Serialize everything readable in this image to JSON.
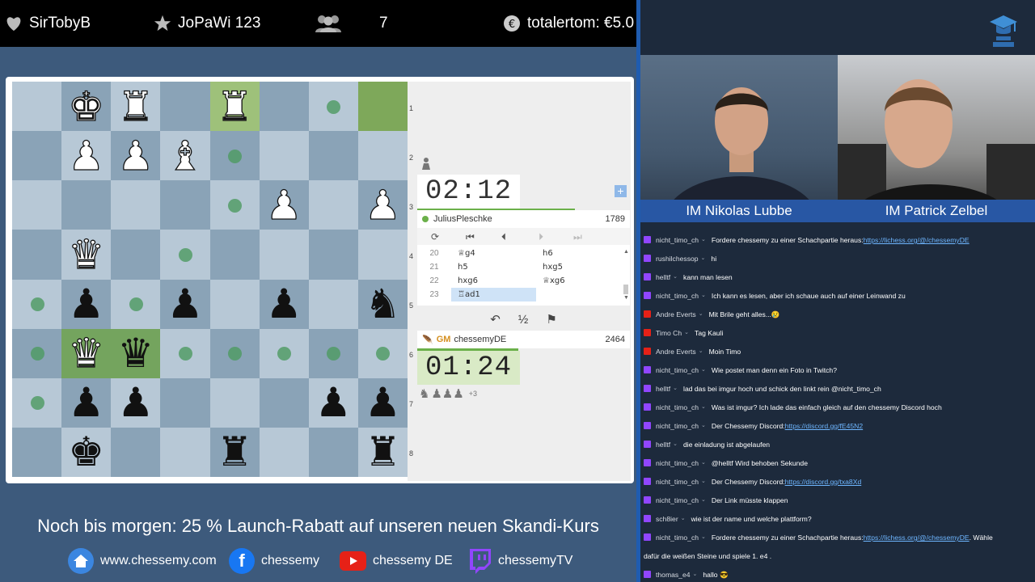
{
  "topbar": {
    "follower": "SirTobyB",
    "subscriber": "JoPaWi 123",
    "viewers": "7",
    "donation": "totalertom: €5.0"
  },
  "board": {
    "squares": [
      [
        "",
        "wK",
        "wR",
        "",
        "wR",
        "",
        "",
        ""
      ],
      [
        "",
        "wP",
        "wP",
        "wB",
        "",
        "",
        "",
        ""
      ],
      [
        "",
        "",
        "",
        "",
        "",
        "wP",
        "",
        "wP"
      ],
      [
        "",
        "wQ",
        "",
        "",
        "",
        "",
        "",
        ""
      ],
      [
        "",
        "bP",
        "",
        "bP",
        "",
        "bP",
        "",
        "bN"
      ],
      [
        "",
        "wbQ",
        "bQ",
        "",
        "",
        "",
        "",
        ""
      ],
      [
        "",
        "bP",
        "bP",
        "",
        "",
        "",
        "bP",
        "bP"
      ],
      [
        "",
        "bK",
        "",
        "",
        "bR",
        "",
        "",
        "bR"
      ]
    ],
    "dots": [
      [
        0,
        6
      ],
      [
        1,
        4
      ],
      [
        2,
        4
      ],
      [
        3,
        3
      ],
      [
        4,
        0
      ],
      [
        4,
        2
      ],
      [
        5,
        0
      ],
      [
        5,
        3
      ],
      [
        5,
        4
      ],
      [
        5,
        5
      ],
      [
        5,
        6
      ],
      [
        5,
        7
      ],
      [
        6,
        0
      ]
    ],
    "highlights": [
      [
        0,
        4,
        "hl"
      ],
      [
        0,
        7,
        "hld"
      ],
      [
        5,
        1,
        "hl2"
      ],
      [
        5,
        2,
        "hl2"
      ]
    ],
    "ranks": [
      "1",
      "2",
      "3",
      "4",
      "5",
      "6",
      "7",
      "8"
    ]
  },
  "game": {
    "top_clock": "02:12",
    "top_player": "JuliusPleschke",
    "top_rating": "1789",
    "bottom_clock": "01:24",
    "bottom_title": "GM",
    "bottom_player": "chessemyDE",
    "bottom_rating": "2464",
    "material": "+3",
    "moves": [
      {
        "num": "20",
        "white": "♕g4",
        "black": "h6"
      },
      {
        "num": "21",
        "white": "h5",
        "black": "hxg5"
      },
      {
        "num": "22",
        "white": "hxg6",
        "black": "♕xg6"
      },
      {
        "num": "23",
        "white": "♖ad1",
        "black": ""
      }
    ],
    "draw_label": "½"
  },
  "promo": "Noch bis morgen: 25 % Launch-Rabatt auf unseren neuen Skandi-Kurs",
  "social": {
    "web": "www.chessemy.com",
    "facebook": "chessemy",
    "youtube": "chessemy DE",
    "twitch": "chessemyTV"
  },
  "cams": {
    "left_name": "IM Nikolas Lubbe",
    "right_name": "IM Patrick Zelbel"
  },
  "colors": {
    "twitch": "#9146ff",
    "youtube": "#e62117",
    "accent": "#2857a4"
  },
  "chat": [
    {
      "p": "twitch",
      "u": "nicht_timo_ch",
      "t": "Fordere chessemy zu einer Schachpartie heraus: ",
      "l": "https://lichess.org/@/chessemyDE"
    },
    {
      "p": "twitch",
      "u": "rushilchessop",
      "t": "hi"
    },
    {
      "p": "twitch",
      "u": "helltf",
      "t": "kann man lesen"
    },
    {
      "p": "twitch",
      "u": "nicht_timo_ch",
      "t": "Ich kann es lesen, aber ich schaue auch auf einer Leinwand zu"
    },
    {
      "p": "youtube",
      "u": "Andre Everts",
      "t": "Mit Brile geht alles...😢"
    },
    {
      "p": "youtube",
      "u": "Timo Ch",
      "t": "Tag Kauli"
    },
    {
      "p": "youtube",
      "u": "Andre Everts",
      "t": "Moin Timo"
    },
    {
      "p": "twitch",
      "u": "nicht_timo_ch",
      "t": "Wie postet man denn ein Foto in Twitch?"
    },
    {
      "p": "twitch",
      "u": "helltf",
      "t": "lad das bei imgur hoch und schick den linkt rein @nicht_timo_ch"
    },
    {
      "p": "twitch",
      "u": "nicht_timo_ch",
      "t": "Was ist imgur? Ich lade das einfach gleich auf den chessemy Discord hoch"
    },
    {
      "p": "twitch",
      "u": "nicht_timo_ch",
      "t": "Der Chessemy Discord: ",
      "l": "https://discord.gg/fE45N2"
    },
    {
      "p": "twitch",
      "u": "helltf",
      "t": "die einladung ist abgelaufen"
    },
    {
      "p": "twitch",
      "u": "nicht_timo_ch",
      "t": "@helltf Wird behoben Sekunde"
    },
    {
      "p": "twitch",
      "u": "nicht_timo_ch",
      "t": "Der Chessemy Discord: ",
      "l": "https://discord.gg/txa8Xd"
    },
    {
      "p": "twitch",
      "u": "nicht_timo_ch",
      "t": "Der Link müsste klappen"
    },
    {
      "p": "twitch",
      "u": "sch8ier",
      "t": "wie ist der name und welche plattform?"
    },
    {
      "p": "twitch",
      "u": "nicht_timo_ch",
      "t": "Fordere chessemy zu einer Schachpartie heraus: ",
      "l": "https://lichess.org/@/chessemyDE",
      "t2": " . Wähle"
    },
    {
      "p": "none",
      "u": "",
      "t": "dafür die weißen Steine und spiele 1. e4 ."
    },
    {
      "p": "twitch",
      "u": "thomas_e4",
      "t": "hallo 😎"
    }
  ]
}
